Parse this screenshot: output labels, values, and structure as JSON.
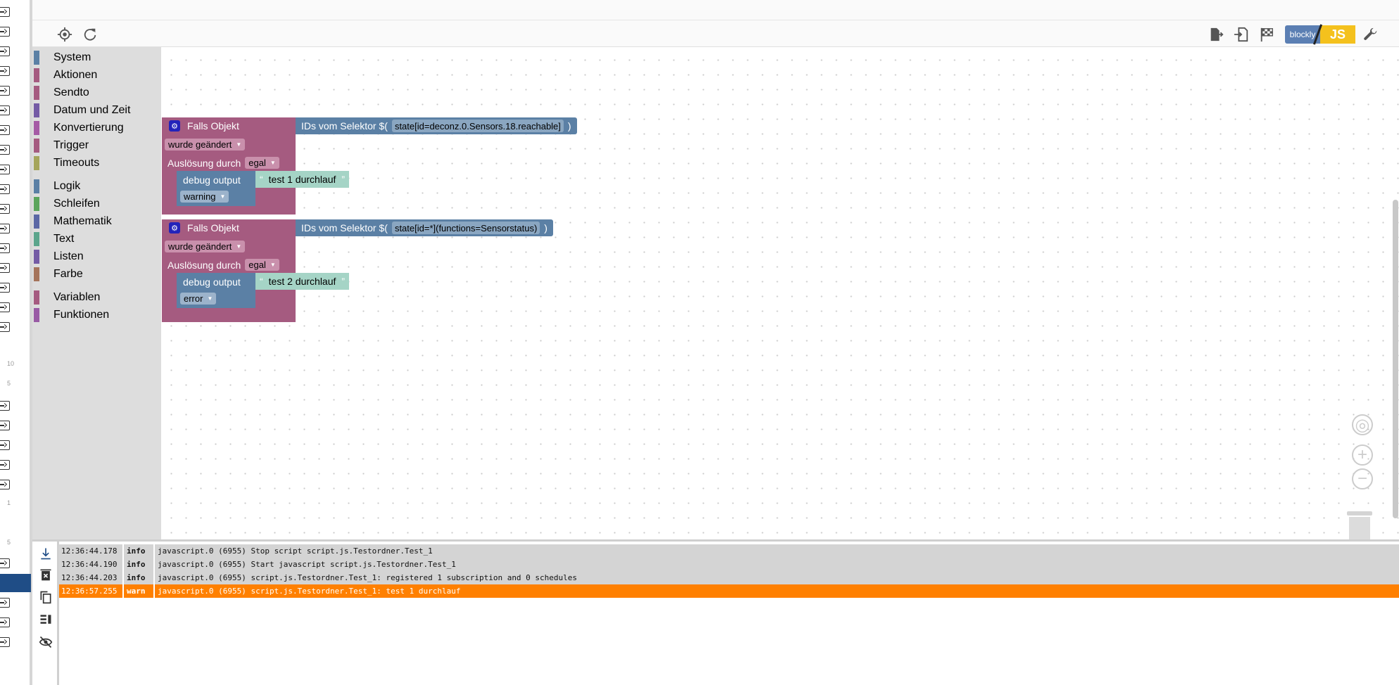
{
  "left_strip": {
    "numbers": [
      "10",
      "5",
      "1",
      "5"
    ]
  },
  "toolbar": {
    "blockly_label": "blockly",
    "js_label": "JS"
  },
  "categories": [
    {
      "label": "System",
      "color": "#5b80a5"
    },
    {
      "label": "Aktionen",
      "color": "#a55b80"
    },
    {
      "label": "Sendto",
      "color": "#a55b80"
    },
    {
      "label": "Datum und Zeit",
      "color": "#745ba5"
    },
    {
      "label": "Konvertierung",
      "color": "#a55ba5"
    },
    {
      "label": "Trigger",
      "color": "#a55b80"
    },
    {
      "label": "Timeouts",
      "color": "#a5a55b"
    },
    {
      "label": "Logik",
      "color": "#5b80a5"
    },
    {
      "label": "Schleifen",
      "color": "#5ba55b"
    },
    {
      "label": "Mathematik",
      "color": "#5b67a5"
    },
    {
      "label": "Text",
      "color": "#5ba58c"
    },
    {
      "label": "Listen",
      "color": "#745ba5"
    },
    {
      "label": "Farbe",
      "color": "#a5745b"
    },
    {
      "label": "Variablen",
      "color": "#a55b80"
    },
    {
      "label": "Funktionen",
      "color": "#995ba5"
    }
  ],
  "blocks": [
    {
      "title": "Falls Objekt",
      "selector_prefix": "IDs vom Selektor $(",
      "selector_value": "state[id=deconz.0.Sensors.18.reachable]",
      "selector_suffix": ")",
      "change": "wurde geändert",
      "trigger_label": "Auslösung durch",
      "trigger_value": "egal",
      "debug_label": "debug output",
      "debug_text": "test 1 durchlauf",
      "debug_level": "warning"
    },
    {
      "title": "Falls Objekt",
      "selector_prefix": "IDs vom Selektor $(",
      "selector_value": "state[id=*](functions=Sensorstatus)",
      "selector_suffix": ")",
      "change": "wurde geändert",
      "trigger_label": "Auslösung durch",
      "trigger_value": "egal",
      "debug_label": "debug output",
      "debug_text": "test 2 durchlauf",
      "debug_level": "error"
    }
  ],
  "log": [
    {
      "time": "12:36:44.178",
      "level": "info",
      "message": "javascript.0 (6955) Stop script script.js.Testordner.Test_1"
    },
    {
      "time": "12:36:44.190",
      "level": "info",
      "message": "javascript.0 (6955) Start javascript script.js.Testordner.Test_1"
    },
    {
      "time": "12:36:44.203",
      "level": "info",
      "message": "javascript.0 (6955) script.js.Testordner.Test_1: registered 1 subscription and 0 schedules"
    },
    {
      "time": "12:36:57.255",
      "level": "warn",
      "message": "javascript.0 (6955) script.js.Testordner.Test_1: test 1 durchlauf"
    }
  ],
  "colors": {
    "warn_row": "#ff8000",
    "block_event": "#a55b80",
    "block_system": "#5b80a5",
    "block_string": "#a5d4c6"
  }
}
